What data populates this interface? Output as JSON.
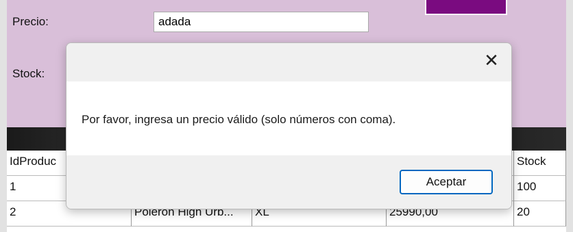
{
  "form": {
    "precio_label": "Precio:",
    "precio_value": "adada",
    "stock_label": "Stock:"
  },
  "grid": {
    "headers": [
      "IdProduc",
      "",
      "",
      "",
      "Stock"
    ],
    "rows": [
      [
        "1",
        "",
        "",
        "",
        "100"
      ],
      [
        "2",
        "Polerón High Urb...",
        "XL",
        "25990,00",
        "20"
      ]
    ]
  },
  "dialog": {
    "close_glyph": "✕",
    "message": "Por favor, ingresa un precio válido (solo números con coma).",
    "ok_label": "Aceptar"
  },
  "colors": {
    "form_background": "#d9bfd9",
    "accent_button": "#7a0b80",
    "focus_border": "#0067c0"
  }
}
